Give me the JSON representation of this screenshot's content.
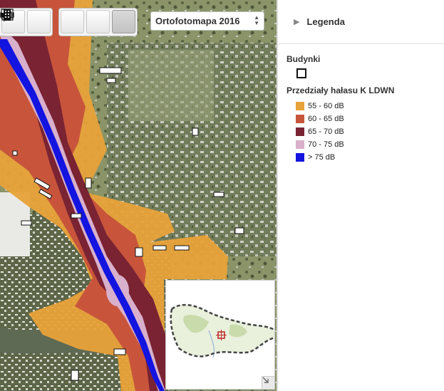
{
  "toolbar": {
    "tools": [
      {
        "name": "measure-distance",
        "icon": "ruler-icon"
      },
      {
        "name": "measure-area",
        "icon": "area-ruler-icon"
      },
      {
        "name": "identify",
        "icon": "info-icon"
      },
      {
        "name": "sound",
        "icon": "speaker-icon"
      },
      {
        "name": "buildings",
        "icon": "building-icon",
        "active": true
      }
    ]
  },
  "basemap": {
    "selected": "Ortofotomapa 2016"
  },
  "legend": {
    "title": "Legenda",
    "layers": {
      "buildings": {
        "title": "Budynki"
      },
      "noise": {
        "title": "Przedziały hałasu K LDWN",
        "classes": [
          {
            "label": "55 - 60 dB",
            "color": "#e8a23a"
          },
          {
            "label": "60 - 65 dB",
            "color": "#c8553b"
          },
          {
            "label": "65 - 70 dB",
            "color": "#7a2333"
          },
          {
            "label": "70 - 75 dB",
            "color": "#d9b0cc"
          },
          {
            "label": "> 75 dB",
            "color": "#1414e0"
          }
        ]
      }
    }
  },
  "overview_map": {
    "has_extent_marker": true
  }
}
